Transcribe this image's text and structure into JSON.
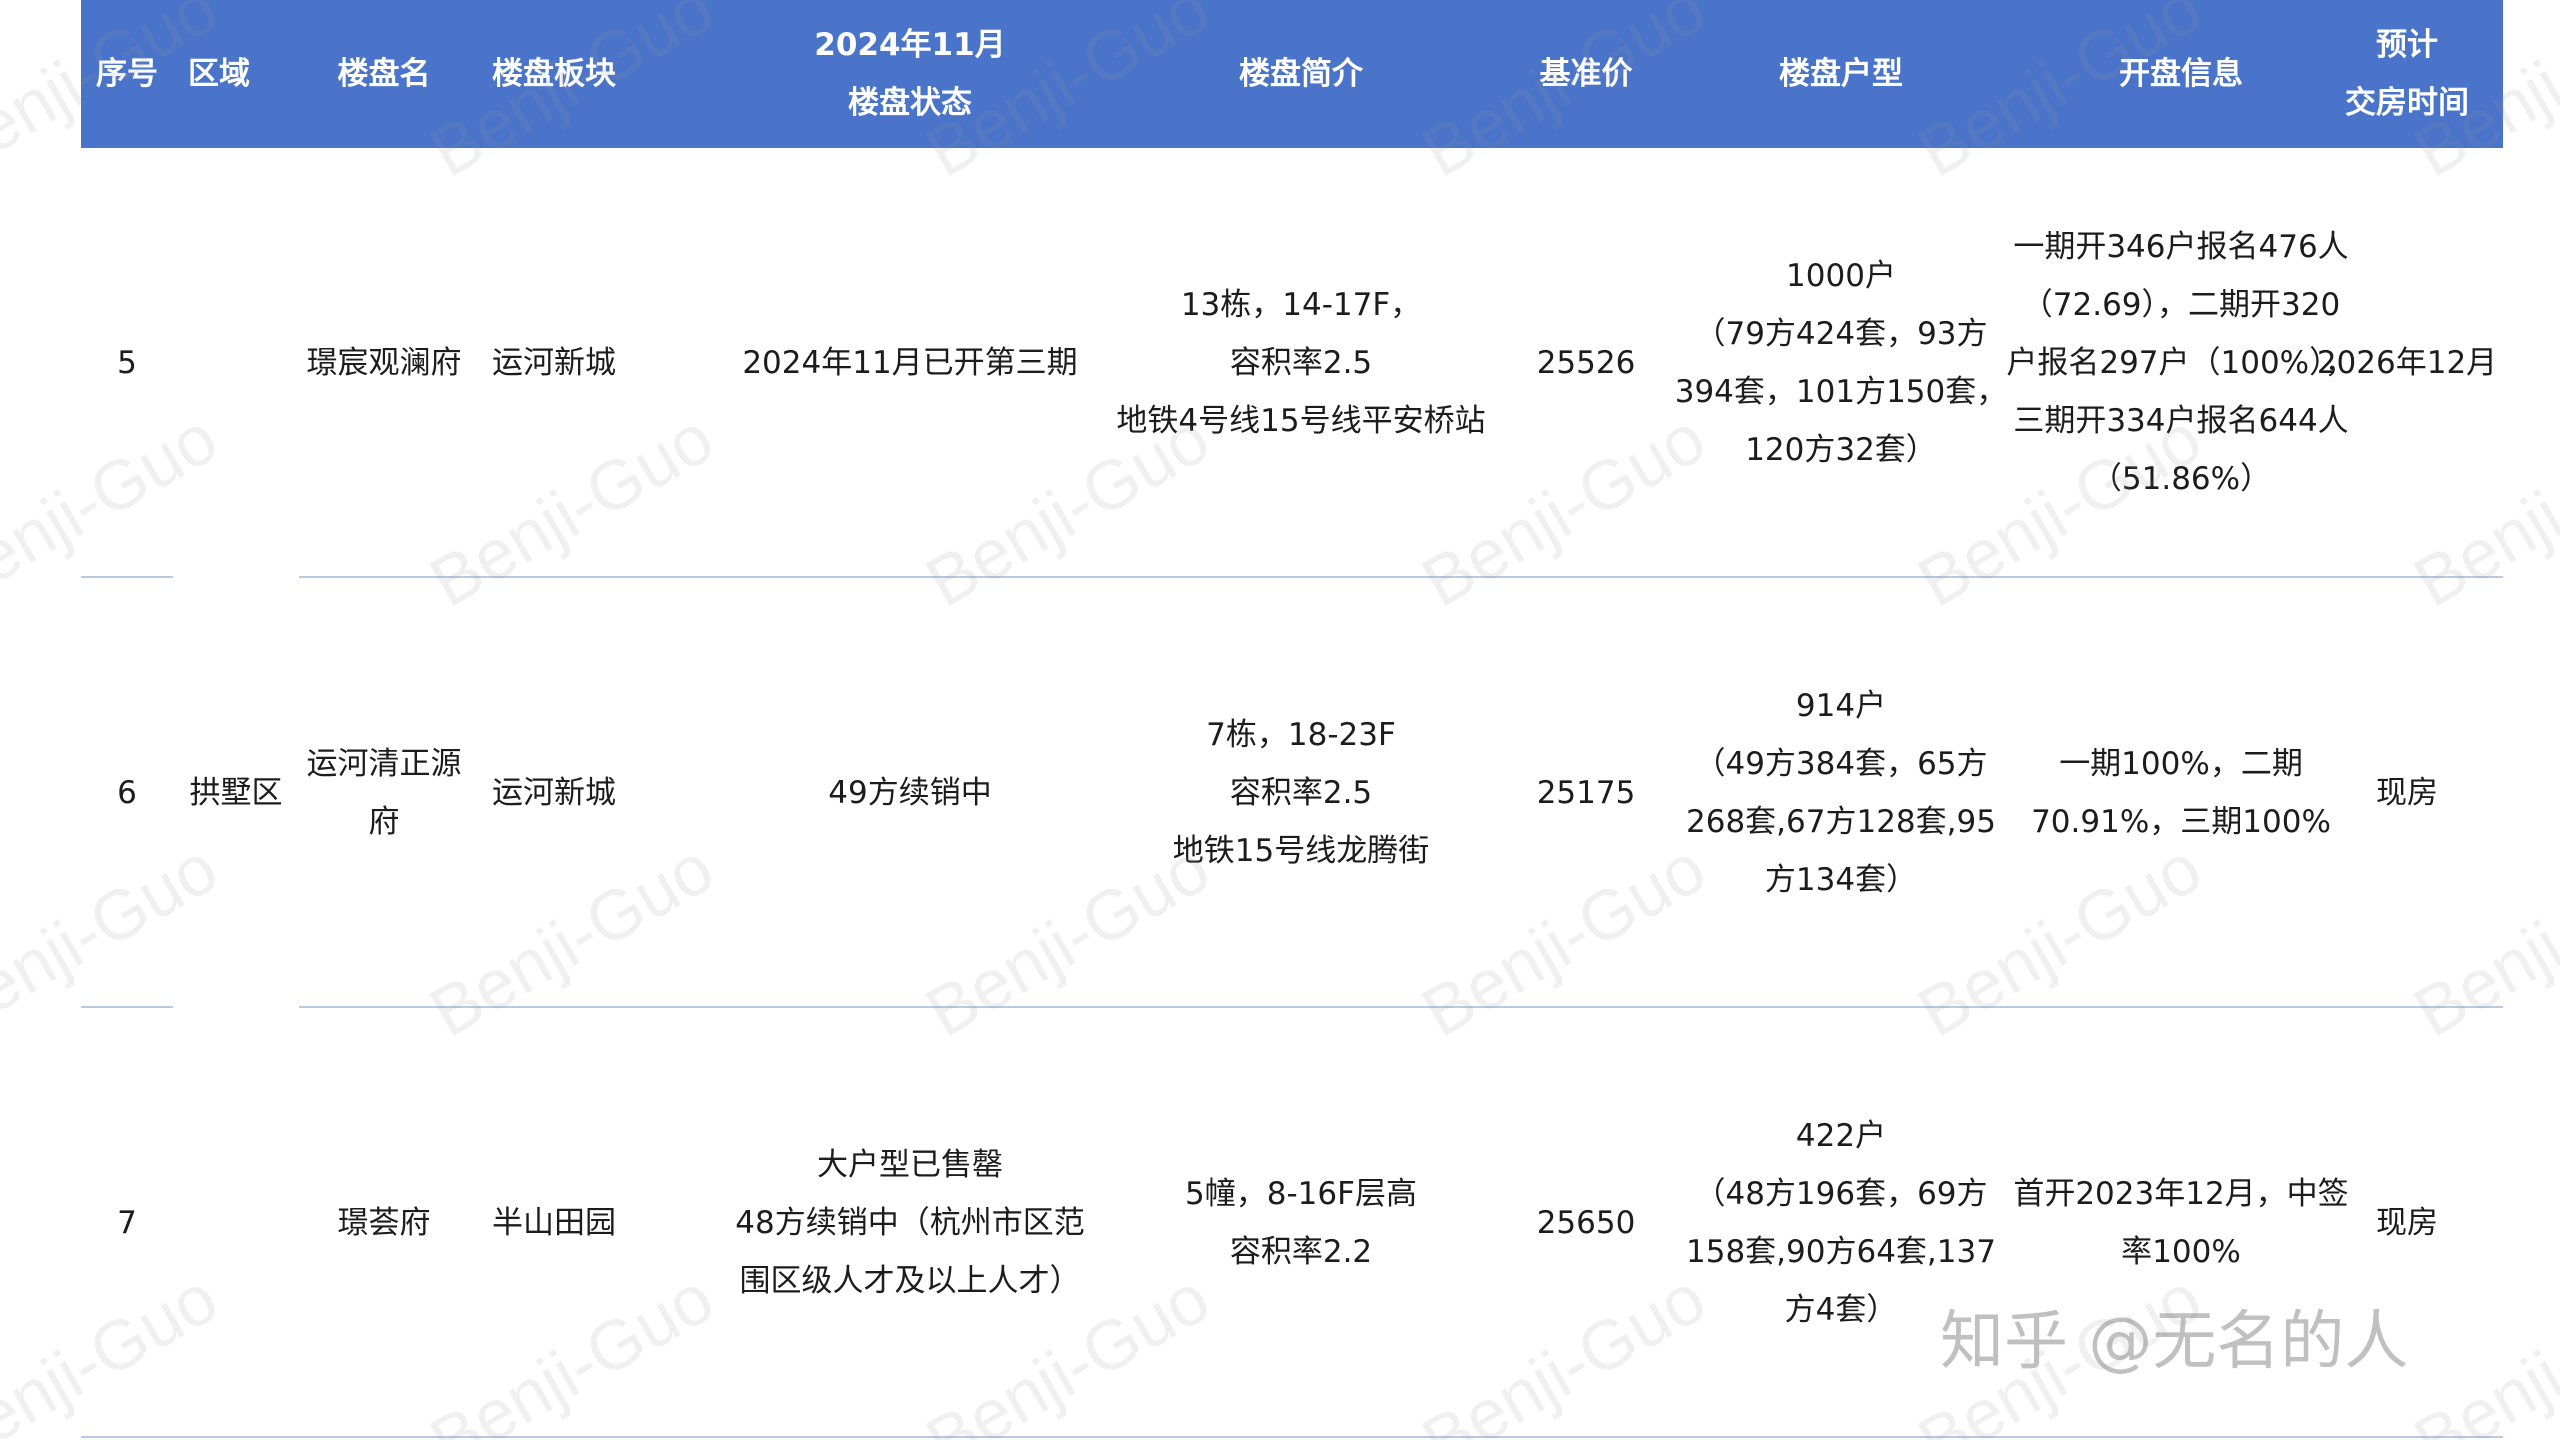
{
  "table": {
    "headers": [
      {
        "lines": [
          "序号"
        ]
      },
      {
        "lines": [
          "区域"
        ]
      },
      {
        "lines": [
          "楼盘名"
        ]
      },
      {
        "lines": [
          "楼盘板块"
        ]
      },
      {
        "lines": [
          "2024年11月",
          "楼盘状态"
        ]
      },
      {
        "lines": [
          "楼盘简介"
        ]
      },
      {
        "lines": [
          "基准价"
        ]
      },
      {
        "lines": [
          "楼盘户型"
        ]
      },
      {
        "lines": [
          "开盘信息"
        ]
      },
      {
        "lines": [
          "预计",
          "交房时间"
        ]
      }
    ],
    "district": "拱墅区",
    "rows": [
      {
        "no": "5",
        "name": [
          "璟宸观澜府"
        ],
        "block": "运河新城",
        "status": [
          "2024年11月已开第三期"
        ],
        "intro": [
          "13栋，14-17F，",
          "容积率2.5",
          "地铁4号线15号线平安桥站"
        ],
        "price": "25526",
        "units": [
          "1000户",
          "（79方424套，93方",
          "394套，101方150套，",
          "120方32套）"
        ],
        "opening": [
          "一期开346户报名476人",
          "（72.69），二期开320",
          "户报名297户（100%），",
          "三期开334户报名644人",
          "（51.86%）"
        ],
        "delivery": "2026年12月"
      },
      {
        "no": "6",
        "name": [
          "运河清正源",
          "府"
        ],
        "block": "运河新城",
        "status": [
          "49方续销中"
        ],
        "intro": [
          "7栋，18-23F",
          "容积率2.5",
          "地铁15号线龙腾街"
        ],
        "price": "25175",
        "units": [
          "914户",
          "（49方384套，65方",
          "268套,67方128套,95",
          "方134套）"
        ],
        "opening": [
          "一期100%，二期",
          "70.91%，三期100%"
        ],
        "delivery": "现房"
      },
      {
        "no": "7",
        "name": [
          "璟荟府"
        ],
        "block": "半山田园",
        "status": [
          "大户型已售罄",
          "48方续销中（杭州市区范",
          "围区级人才及以上人才）"
        ],
        "intro": [
          "5幢，8-16F层高",
          "容积率2.2"
        ],
        "price": "25650",
        "units": [
          "422户",
          "（48方196套，69方",
          "158套,90方64套,137",
          "方4套）"
        ],
        "opening": [
          "首开2023年12月，中签",
          "率100%"
        ],
        "delivery": "现房"
      }
    ]
  },
  "watermark": "Benji-Guo",
  "brand": "知乎 @无名的人",
  "colors": {
    "header_bg": "#4a74c9",
    "header_text": "#ffffff",
    "row_line": "#b8c9e3"
  }
}
